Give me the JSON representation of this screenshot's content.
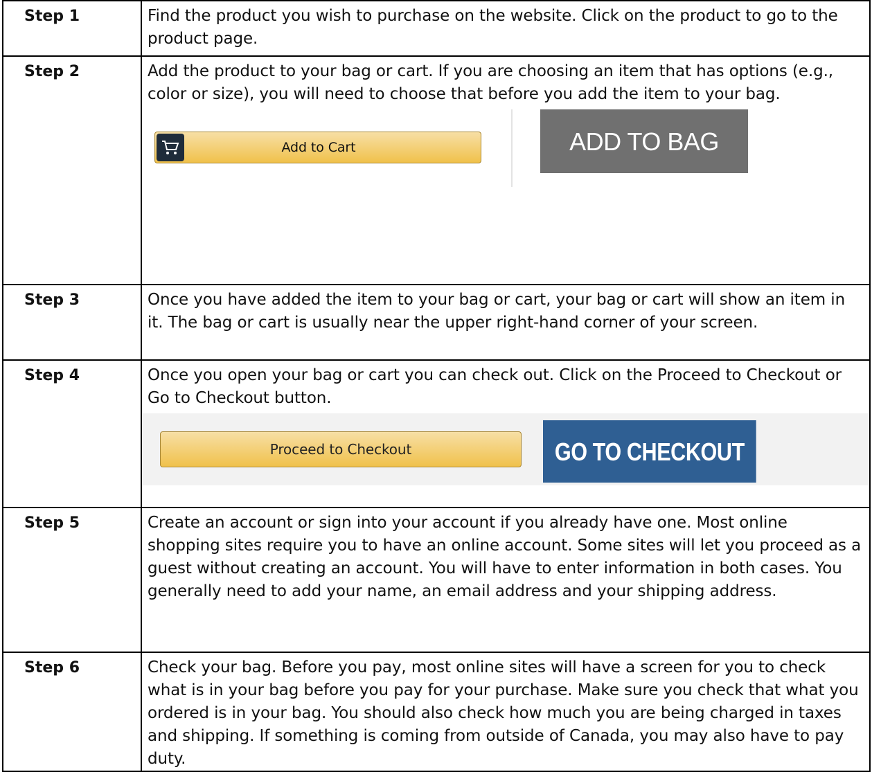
{
  "steps": [
    {
      "label": "Step 1",
      "text": "Find the product you wish to purchase on the website. Click on the product to go to the product page."
    },
    {
      "label": "Step 2",
      "text": "Add the product to your bag or cart. If you are choosing an item that has options (e.g., color or size), you will need to choose that before you add the item to your bag."
    },
    {
      "label": "Step 3",
      "text": "Once you have added the item to your bag or cart, your bag or cart will show an item in it. The bag or cart is usually near the upper right-hand corner of your screen."
    },
    {
      "label": "Step 4",
      "text": "Once you open your bag or cart you can check out. Click on the Proceed to Checkout or Go to Checkout button."
    },
    {
      "label": "Step 5",
      "text": "Create an account or sign into your account if you already have one. Most online shopping sites require you to have an online account. Some sites will let you proceed as a guest without creating an account.  You will have to enter information in both cases. You generally need to add your name, an email address and your shipping address."
    },
    {
      "label": "Step 6",
      "text": "Check your bag.  Before you pay, most online sites will have a screen for you to check what is in your bag before you pay for your purchase. Make sure you check that what you ordered is in your bag. You should also check how much you are being charged in taxes and shipping. If something is coming from outside of Canada, you may also have to pay duty."
    }
  ],
  "buttons": {
    "add_to_cart": "Add to Cart",
    "add_to_bag": "ADD TO BAG",
    "proceed_to_checkout": "Proceed to Checkout",
    "go_to_checkout": "GO TO CHECKOUT"
  },
  "icons": {
    "cart": "shopping-cart-icon"
  },
  "colors": {
    "amazon_button": "#f0c14b",
    "add_to_bag_bg": "#707070",
    "go_to_checkout_bg": "#2f5f93"
  }
}
